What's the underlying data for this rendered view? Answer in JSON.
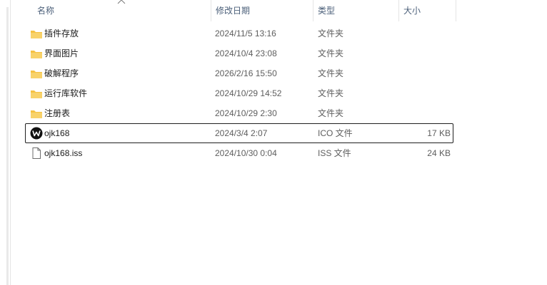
{
  "columns": {
    "name": "名称",
    "date": "修改日期",
    "type": "类型",
    "size": "大小"
  },
  "sort": {
    "column": "name",
    "direction": "ascending",
    "icon": "sort-up-caret-icon"
  },
  "files": [
    {
      "name": "插件存放",
      "date": "2024/11/5 13:16",
      "type": "文件夹",
      "size": "",
      "icon": "folder-icon"
    },
    {
      "name": "界面图片",
      "date": "2024/10/4 23:08",
      "type": "文件夹",
      "size": "",
      "icon": "folder-icon"
    },
    {
      "name": "破解程序",
      "date": "2026/2/16 15:50",
      "type": "文件夹",
      "size": "",
      "icon": "folder-icon"
    },
    {
      "name": "运行库软件",
      "date": "2024/10/29 14:52",
      "type": "文件夹",
      "size": "",
      "icon": "folder-icon"
    },
    {
      "name": "注册表",
      "date": "2024/10/29 2:30",
      "type": "文件夹",
      "size": "",
      "icon": "folder-icon"
    },
    {
      "name": "ojk168",
      "date": "2024/3/4 2:07",
      "type": "ICO 文件",
      "size": "17 KB",
      "icon": "ico-file-icon",
      "focused": true
    },
    {
      "name": "ojk168.iss",
      "date": "2024/10/30 0:04",
      "type": "ISS 文件",
      "size": "24 KB",
      "icon": "document-file-icon"
    }
  ],
  "colors": {
    "header_text": "#4c607a",
    "folder_yellow": "#f5c244",
    "focus_border": "#1f1f1f"
  }
}
